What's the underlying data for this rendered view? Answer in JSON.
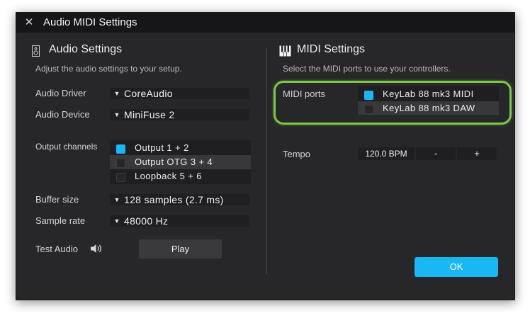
{
  "window": {
    "title": "Audio MIDI Settings",
    "close_icon": "close-icon"
  },
  "audio": {
    "title": "Audio Settings",
    "icon": "speaker-icon",
    "subtitle": "Adjust the audio settings to your setup.",
    "driver_label": "Audio Driver",
    "driver_value": "CoreAudio",
    "device_label": "Audio Device",
    "device_value": "MiniFuse 2",
    "output_label": "Output channels",
    "outputs": [
      {
        "label": "Output 1 + 2",
        "checked": true
      },
      {
        "label": "Output OTG 3 + 4",
        "checked": false
      },
      {
        "label": "Loopback 5 + 6",
        "checked": false
      }
    ],
    "buffer_label": "Buffer size",
    "buffer_value": "128 samples (2.7 ms)",
    "rate_label": "Sample rate",
    "rate_value": "48000 Hz",
    "test_label": "Test Audio",
    "test_icon": "volume-icon",
    "play_label": "Play"
  },
  "midi": {
    "title": "MIDI Settings",
    "icon": "piano-keys-icon",
    "subtitle": "Select the MIDI ports to use your controllers.",
    "ports_label": "MIDI ports",
    "ports": [
      {
        "label": "KeyLab 88 mk3 MIDI",
        "checked": true
      },
      {
        "label": "KeyLab 88 mk3 DAW",
        "checked": false
      }
    ],
    "tempo_label": "Tempo",
    "tempo_value": "120.0 BPM",
    "tempo_minus": "-",
    "tempo_plus": "+"
  },
  "ok_label": "OK",
  "colors": {
    "accent": "#1ab7f5",
    "highlight_ring": "#7ac943"
  }
}
